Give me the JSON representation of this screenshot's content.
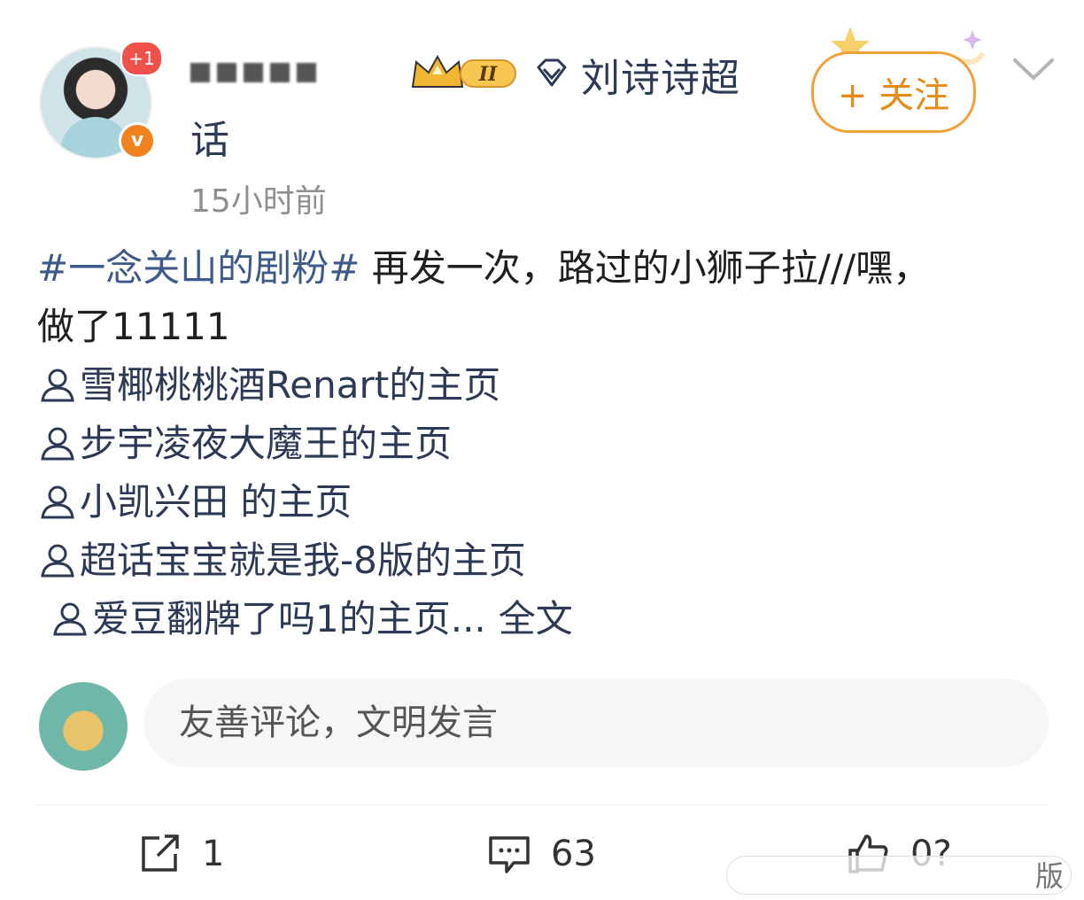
{
  "header": {
    "notification_badge": "+1",
    "verified_mark": "v",
    "username": "",
    "badge_level": "II",
    "supertopic_part1": "刘诗诗超",
    "supertopic_part2": "话",
    "timestamp": "15小时前",
    "follow_label": "+ 关注"
  },
  "post": {
    "hashtag": "#一念关山的剧粉#",
    "text_line1": " 再发一次，路过的小狮子拉///嘿，",
    "text_line2": "做了11111",
    "mentions": [
      "雪椰桃桃酒Renart的主页",
      "步宇凌夜大魔王的主页",
      "小凯兴田 的主页",
      "超话宝宝就是我-8版的主页"
    ],
    "last_mention": "爱豆翻牌了吗1的主页",
    "ellipsis": "...",
    "full_text_link": "全文"
  },
  "comment": {
    "placeholder": "友善评论，文明发言"
  },
  "actions": {
    "share_count": "1",
    "comment_count": "63",
    "like_count": "0?"
  },
  "watermark": "版",
  "colors": {
    "accent_orange": "#e88a18",
    "link_blue": "#3d5a8a",
    "badge_red": "#f0504a"
  }
}
